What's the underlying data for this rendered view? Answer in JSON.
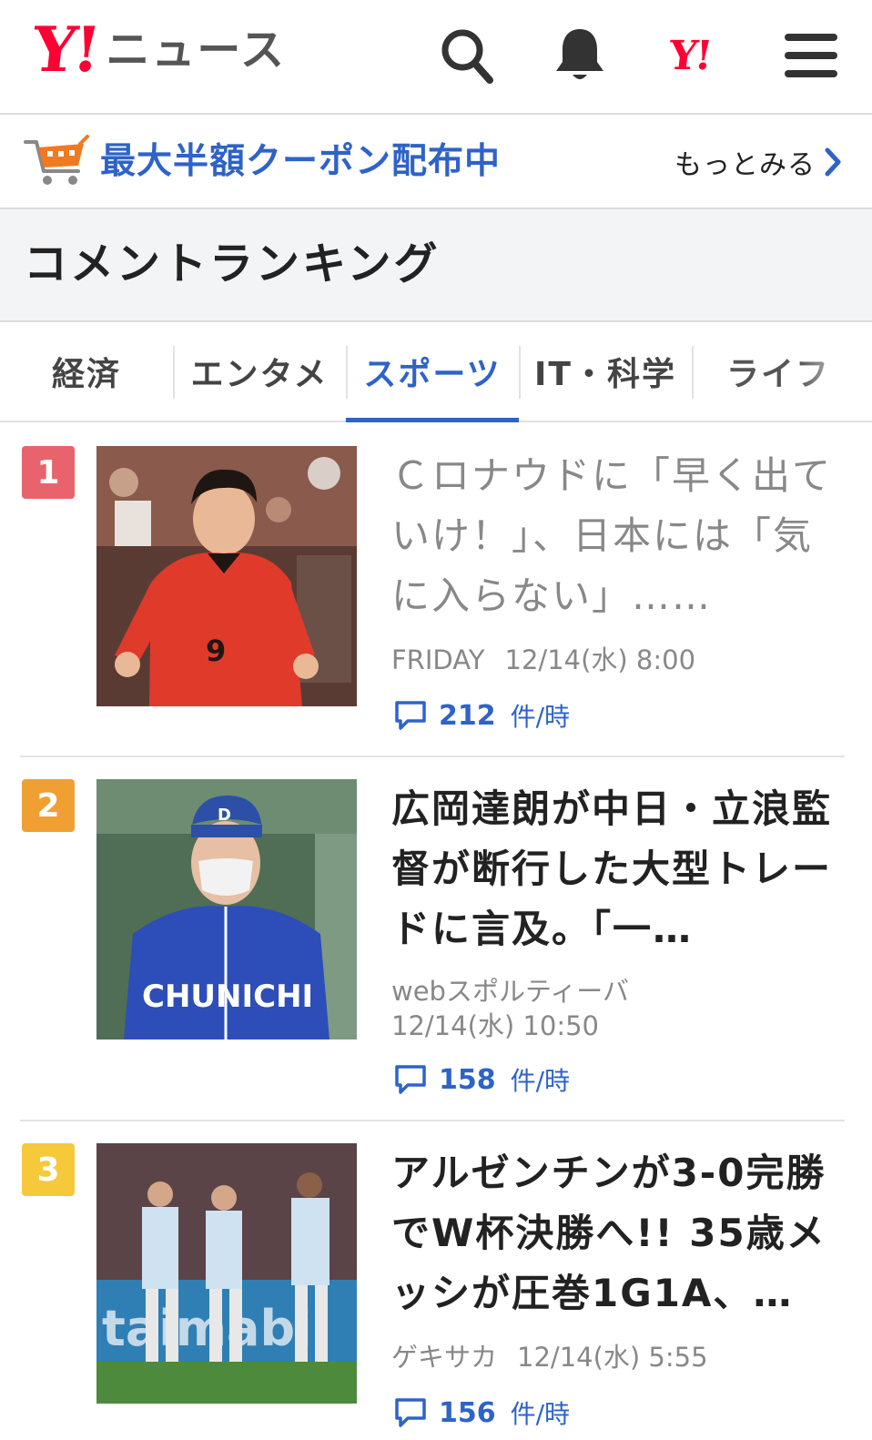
{
  "header": {
    "logo_mark": "Y!",
    "logo_text": "ニュース",
    "yj_mark": "Y!",
    "icons": [
      "search-icon",
      "bell-icon",
      "yahoo-japan-icon",
      "menu-icon"
    ]
  },
  "coupon": {
    "text": "最大半額クーポン配布中",
    "more": "もっとみる",
    "icon": "cart-icon"
  },
  "section": {
    "title": "コメントランキング"
  },
  "tabs": [
    {
      "label": "経済",
      "active": false
    },
    {
      "label": "エンタメ",
      "active": false
    },
    {
      "label": "スポーツ",
      "active": true
    },
    {
      "label": "IT・科学",
      "active": false
    },
    {
      "label": "ライフ",
      "active": false
    }
  ],
  "colors": {
    "accent": "#2e63c8",
    "rank1": "#e8636b",
    "rank2": "#f0a033",
    "rank3": "#f5c93a",
    "brand_red": "#ff0033"
  },
  "articles": [
    {
      "rank": "1",
      "headline": "Ｃロナウドに「早く出ていけ！」、日本には「気に入らない」……",
      "source": "FRIDAY",
      "date": "12/14(水) 8:00",
      "comments": "212",
      "unit": "件/時",
      "visited": true
    },
    {
      "rank": "2",
      "headline": "広岡達朗が中日・立浪監督が断行した大型トレードに言及。「一…",
      "source": "webスポルティーバ",
      "date": "12/14(水) 10:50",
      "comments": "158",
      "unit": "件/時",
      "visited": false
    },
    {
      "rank": "3",
      "headline": "アルゼンチンが3-0完勝でW杯決勝へ!! 35歳メッシが圧巻1G1A、…",
      "source": "ゲキサカ",
      "date": "12/14(水) 5:55",
      "comments": "156",
      "unit": "件/時",
      "visited": false
    }
  ]
}
